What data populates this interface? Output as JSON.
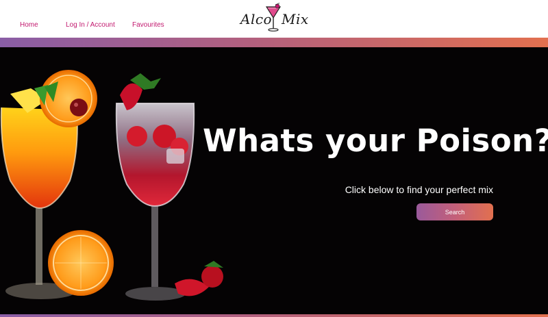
{
  "nav": {
    "home": "Home",
    "login": "Log In / Account",
    "favourites": "Favourites"
  },
  "logo": {
    "left_text": "Alco",
    "right_text": "Mix",
    "icon": "cocktail-glass-icon"
  },
  "hero": {
    "title": "Whats your Poison?",
    "subtitle": "Click below to find your perfect mix",
    "search_button": "Search",
    "image": "cocktails-photo"
  },
  "colors": {
    "nav_link": "#c2186e",
    "gradient_start": "#8a5ea6",
    "gradient_end": "#e2704f",
    "hero_bg": "#050304"
  }
}
